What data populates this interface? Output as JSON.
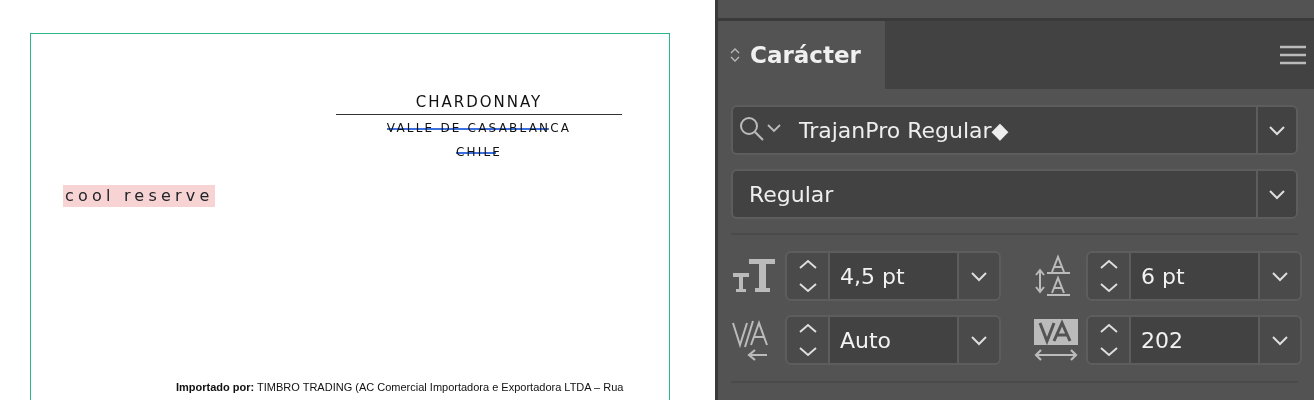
{
  "document": {
    "title": "CHARDONNAY",
    "text_lines": [
      {
        "text": "VALLE DE CASABLANCA",
        "selected": true
      },
      {
        "text": "CHILE",
        "selected": true
      }
    ],
    "tagline": {
      "text": "cool reserve",
      "highlighted": true
    },
    "importer": "**Importado por:** TIMBRO TRADING (AC Comercial Importadora e Exportadora LTDA – Rua"
  },
  "panel": {
    "tabs": [
      {
        "label": "Carácter",
        "selected": true
      }
    ],
    "font_family": "TrajanPro Regular◆",
    "font_style": "Regular",
    "fields": [
      {
        "kind": "size",
        "value": "4,5 pt"
      },
      {
        "kind": "leading",
        "value": "6 pt"
      },
      {
        "kind": "kerning",
        "value": "Auto"
      },
      {
        "kind": "tracking",
        "value": "202"
      }
    ]
  }
}
